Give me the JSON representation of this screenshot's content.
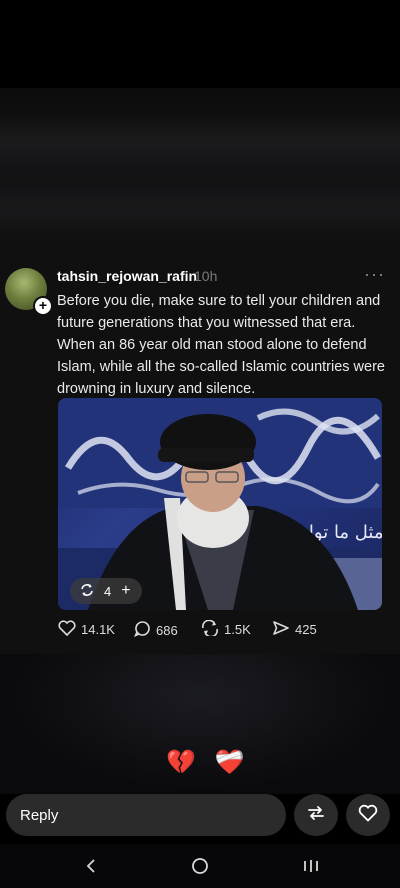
{
  "post": {
    "username": "tahsin_rejowan_rafin",
    "time": "10h",
    "more": "···",
    "text": "Before you die, make sure to tell your children and future generations that you witnessed that era. When an 86 year old man stood alone to defend Islam, while all the so-called Islamic countries were drowning in luxury and silence.",
    "image": {
      "repost_count": "4",
      "add_label": "+",
      "caption_script": "مثل ما تواصل"
    },
    "actions": {
      "likes": "14.1K",
      "comments": "686",
      "reposts": "1.5K",
      "shares": "425"
    }
  },
  "reactions": "💔 ❤️‍🩹",
  "reply": {
    "label": "Reply"
  },
  "icons": {
    "heart": "heart-icon",
    "comment": "comment-icon",
    "repost": "repost-icon",
    "share": "share-icon",
    "back": "back-icon",
    "home": "home-icon",
    "recents": "recents-icon"
  },
  "colors": {
    "background": "#000000",
    "post_bg": "#101010",
    "image_bg": "#23337a",
    "reply_bg": "#2b2b2b"
  }
}
